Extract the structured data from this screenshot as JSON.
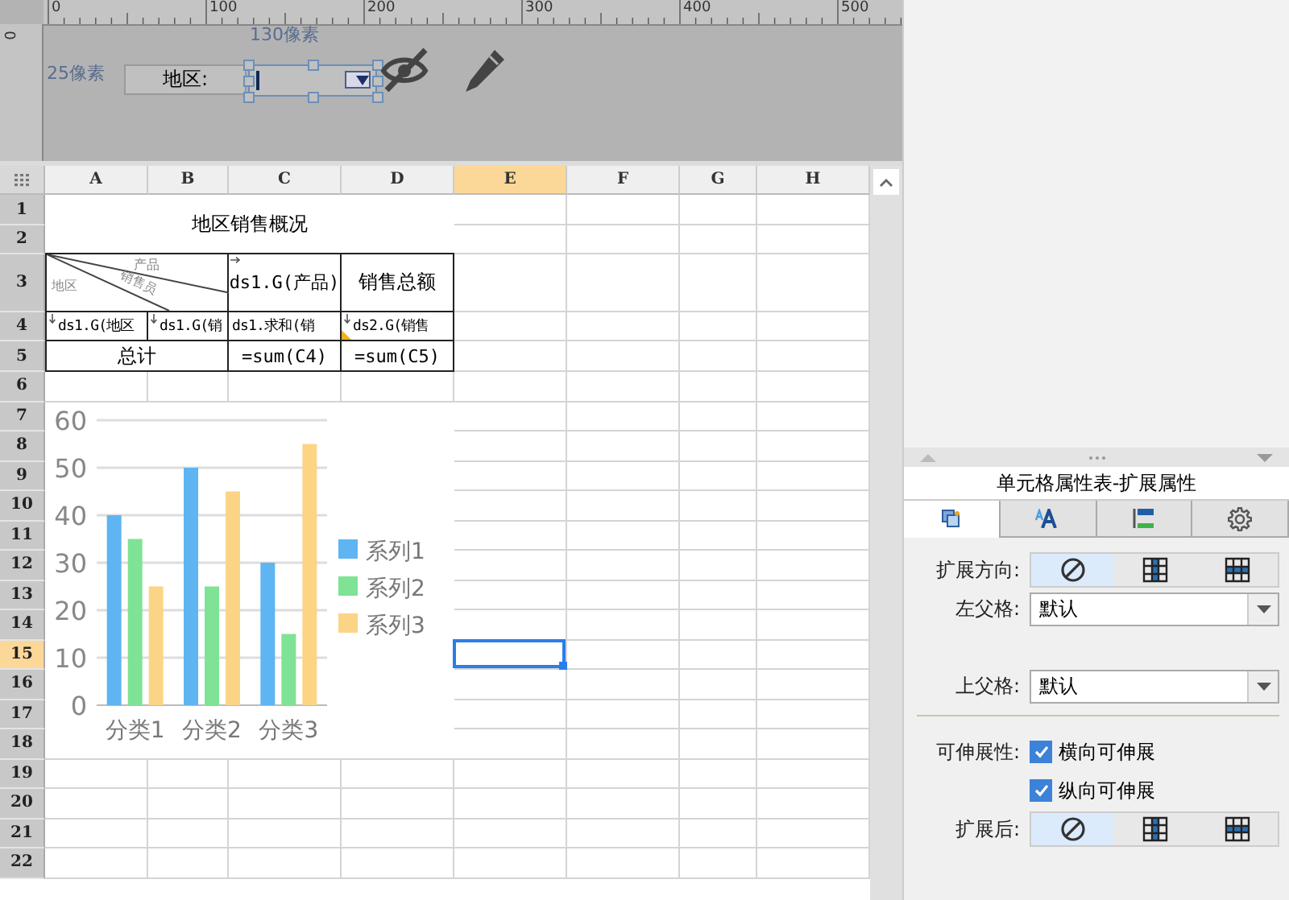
{
  "designer": {
    "ruler_labels": [
      "0",
      "100",
      "200",
      "300",
      "400",
      "500"
    ],
    "vertical_ruler_label": "0",
    "width_hint": "130像素",
    "height_hint": "25像素",
    "field_label": "地区:",
    "combo": {
      "selected": true
    }
  },
  "sheet": {
    "columns": [
      {
        "label": "A",
        "selected": false
      },
      {
        "label": "B",
        "selected": false
      },
      {
        "label": "C",
        "selected": false
      },
      {
        "label": "D",
        "selected": false
      },
      {
        "label": "E",
        "selected": true
      },
      {
        "label": "F",
        "selected": false
      },
      {
        "label": "G",
        "selected": false
      },
      {
        "label": "H",
        "selected": false
      }
    ],
    "rows": [
      {
        "label": "1",
        "selected": false
      },
      {
        "label": "2",
        "selected": false
      },
      {
        "label": "3",
        "selected": false
      },
      {
        "label": "4",
        "selected": false
      },
      {
        "label": "5",
        "selected": false
      },
      {
        "label": "6",
        "selected": false
      },
      {
        "label": "7",
        "selected": false
      },
      {
        "label": "8",
        "selected": false
      },
      {
        "label": "9",
        "selected": false
      },
      {
        "label": "10",
        "selected": false
      },
      {
        "label": "11",
        "selected": false
      },
      {
        "label": "12",
        "selected": false
      },
      {
        "label": "13",
        "selected": false
      },
      {
        "label": "14",
        "selected": false
      },
      {
        "label": "15",
        "selected": true
      },
      {
        "label": "16",
        "selected": false
      },
      {
        "label": "17",
        "selected": false
      },
      {
        "label": "18",
        "selected": false
      },
      {
        "label": "19",
        "selected": false
      },
      {
        "label": "20",
        "selected": false
      },
      {
        "label": "21",
        "selected": false
      },
      {
        "label": "22",
        "selected": false
      }
    ],
    "report": {
      "title": "地区销售概况",
      "diagonal_header": {
        "top": "产品",
        "middle": "销售员",
        "left": "地区"
      },
      "header_cells": [
        "ds1.G(产品)",
        "销售总额"
      ],
      "data_cells": [
        "ds1.G(地区",
        "ds1.G(销",
        "ds1.求和(销",
        "ds2.G(销售"
      ],
      "total_cells": [
        "总计",
        "=sum(C4)",
        "=sum(C5)"
      ]
    },
    "chart": {
      "chart_data": {
        "type": "bar",
        "categories": [
          "分类1",
          "分类2",
          "分类3"
        ],
        "series": [
          {
            "name": "系列1",
            "color": "#5fb4f2",
            "values": [
              40,
              50,
              30
            ]
          },
          {
            "name": "系列2",
            "color": "#7ee394",
            "values": [
              35,
              25,
              15
            ]
          },
          {
            "name": "系列3",
            "color": "#fcd486",
            "values": [
              25,
              45,
              55
            ]
          }
        ],
        "ylim": [
          0,
          60
        ],
        "yticks": [
          0,
          10,
          20,
          30,
          40,
          50,
          60
        ],
        "grid": true,
        "legend": true
      }
    }
  },
  "panel": {
    "title": "单元格属性表-扩展属性",
    "tabs": [
      {
        "kind": "cell",
        "selected": true
      },
      {
        "kind": "font",
        "selected": false
      },
      {
        "kind": "widget",
        "selected": false
      },
      {
        "kind": "settings",
        "selected": false
      }
    ],
    "expand_direction": {
      "label": "扩展方向:",
      "options": [
        {
          "kind": "none",
          "selected": true
        },
        {
          "kind": "vertical",
          "selected": false
        },
        {
          "kind": "horizontal",
          "selected": false
        }
      ]
    },
    "left_parent": {
      "label": "左父格:",
      "value": "默认"
    },
    "top_parent": {
      "label": "上父格:",
      "value": "默认"
    },
    "stretch": {
      "label": "可伸展性:",
      "options": [
        {
          "label": "横向可伸展",
          "checked": true
        },
        {
          "label": "纵向可伸展",
          "checked": true
        }
      ]
    },
    "after_expand": {
      "label": "扩展后:",
      "options": [
        {
          "kind": "none",
          "selected": true
        },
        {
          "kind": "vertical",
          "selected": false
        },
        {
          "kind": "horizontal",
          "selected": false
        }
      ]
    }
  }
}
